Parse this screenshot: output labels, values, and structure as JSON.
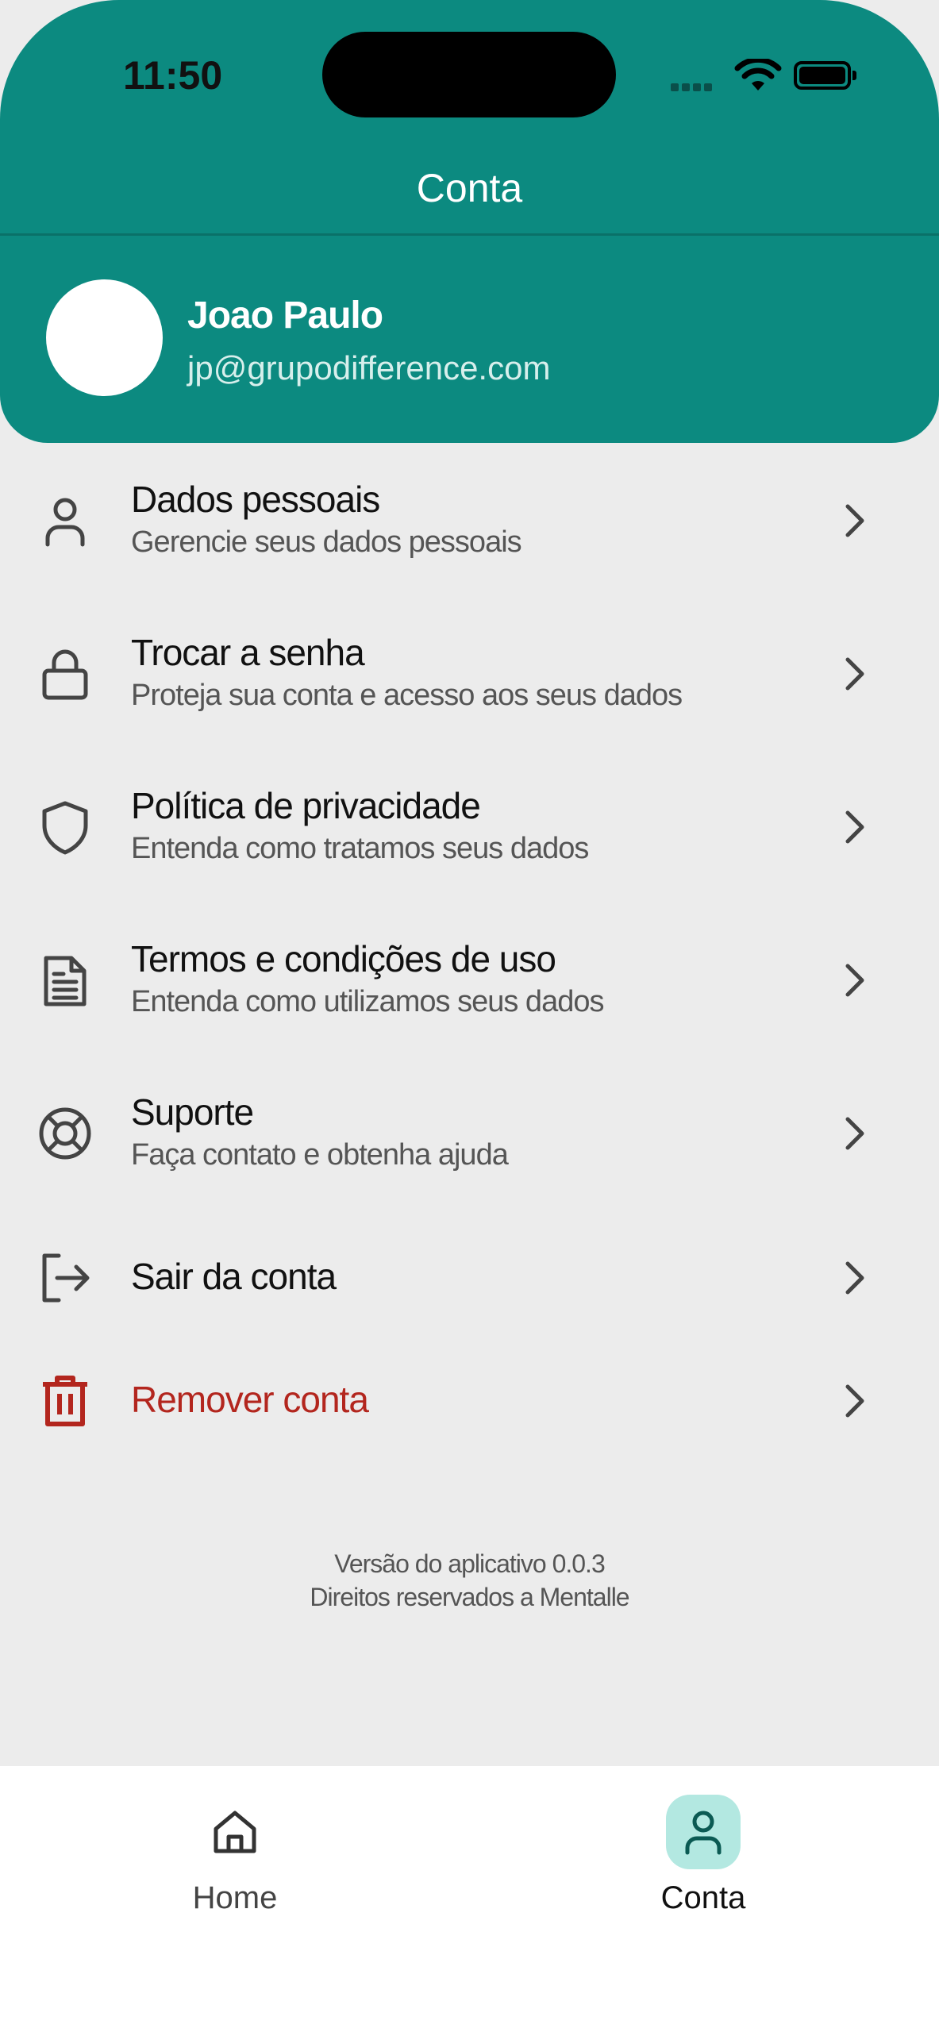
{
  "status_bar": {
    "time": "11:50"
  },
  "header": {
    "title": "Conta",
    "user": {
      "name": "Joao Paulo",
      "email": "jp@grupodifference.com"
    }
  },
  "menu": [
    {
      "title": "Dados pessoais",
      "subtitle": "Gerencie seus dados pessoais",
      "icon": "person-icon"
    },
    {
      "title": "Trocar a senha",
      "subtitle": "Proteja sua conta e acesso aos seus dados",
      "icon": "lock-icon"
    },
    {
      "title": "Política de privacidade",
      "subtitle": "Entenda como tratamos seus dados",
      "icon": "shield-icon"
    },
    {
      "title": "Termos e condições de uso",
      "subtitle": "Entenda como utilizamos seus dados",
      "icon": "document-icon"
    },
    {
      "title": "Suporte",
      "subtitle": "Faça contato e obtenha ajuda",
      "icon": "lifebuoy-icon"
    },
    {
      "title": "Sair da conta",
      "icon": "logout-icon"
    },
    {
      "title": "Remover conta",
      "icon": "trash-icon",
      "color": "#b3261e"
    }
  ],
  "footer": {
    "version": "Versão do aplicativo 0.0.3",
    "rights": "Direitos reservados a Mentalle"
  },
  "bottom_nav": [
    {
      "label": "Home",
      "icon": "home-icon",
      "active": false
    },
    {
      "label": "Conta",
      "icon": "person-icon",
      "active": true
    }
  ],
  "colors": {
    "primary": "#0c8a80",
    "danger": "#b3261e",
    "active_nav_bg": "#b3e8e1",
    "background": "#ececec"
  }
}
